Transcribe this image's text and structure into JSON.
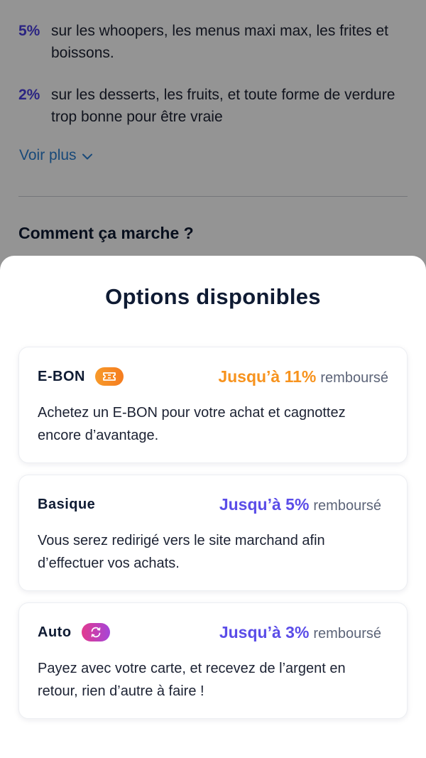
{
  "background": {
    "rates": [
      {
        "percent": "5%",
        "text": "sur les whoopers, les menus maxi max, les frites et boissons."
      },
      {
        "percent": "2%",
        "text": "sur les desserts, les fruits, et toute forme de verdure trop bonne pour être vraie"
      }
    ],
    "see_more_label": "Voir plus",
    "section_title": "Comment ça marche ?"
  },
  "sheet": {
    "title": "Options disponibles",
    "options": [
      {
        "name": "E-BON",
        "badge_icon": "ticket-icon",
        "rate": "Jusqu’à 11%",
        "rate_suffix": "remboursé",
        "rate_color": "#f7931e",
        "description": "Achetez un E-BON pour votre achat et cagnottez encore d’avantage."
      },
      {
        "name": "Basique",
        "rate": "Jusqu’à 5%",
        "rate_suffix": "remboursé",
        "rate_color": "#5b4de8",
        "description": "Vous serez redirigé vers le site marchand afin d’effectuer vos achats."
      },
      {
        "name": "Auto",
        "badge_icon": "refresh-icon",
        "rate": "Jusqu’à 3%",
        "rate_suffix": "remboursé",
        "rate_color": "#5b4de8",
        "description": "Payez avec votre carte, et recevez de l’argent en retour, rien d’autre à faire !"
      }
    ]
  },
  "colors": {
    "accent": "#4b3ee0",
    "orange": "#f7931e",
    "link": "#2a7fd0"
  }
}
